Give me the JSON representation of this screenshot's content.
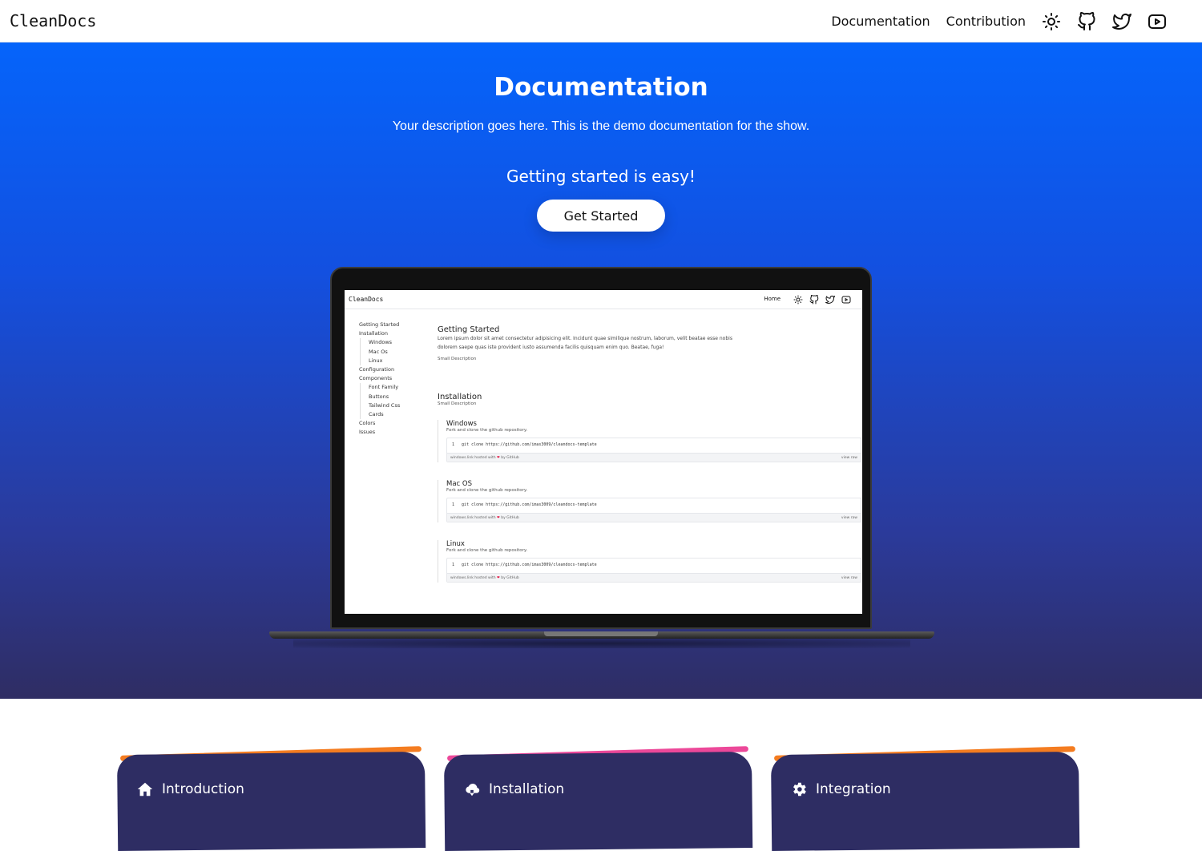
{
  "navbar": {
    "brand": "CleanDocs",
    "links": [
      "Documentation",
      "Contribution"
    ],
    "icons": [
      "sun-icon",
      "github-icon",
      "twitter-icon",
      "youtube-icon"
    ]
  },
  "hero": {
    "title": "Documentation",
    "description": "Your description goes here. This is the demo documentation for the show.",
    "subtitle": "Getting started is easy!",
    "cta_label": "Get Started",
    "gradient_colors": [
      "#0564fb",
      "#2f2d63"
    ]
  },
  "preview": {
    "brand": "CleanDocs",
    "nav_link": "Home",
    "sidebar": {
      "getting_started": "Getting Started",
      "installation": "Installation",
      "install_sub": [
        "Windows",
        "Mac Os",
        "Linux"
      ],
      "configuration": "Configuration",
      "components": "Components",
      "components_sub": [
        "Font Family",
        "Buttons",
        "Tailwind Css",
        "Cards"
      ],
      "colors": "Colors",
      "issues": "Issues"
    },
    "getting_started": {
      "title": "Getting Started",
      "body": "Lorem ipsum dolor sit amet consectetur adipisicing elit. Incidunt quae similique nostrum, laborum, velit beatae esse nobis dolorem saepe quas iste provident iusto assumenda facilis quisquam enim quo. Beatae, fuga!",
      "small": "Small Description"
    },
    "installation": {
      "title": "Installation",
      "small": "Small Description",
      "items": [
        {
          "name": "Windows",
          "desc": "Fork and clone the github repository.",
          "code": "git clone https://github.com/imas3009/cleandocs-template",
          "line": "1",
          "file": "windows.link",
          "hosted": "hosted with",
          "by": "by GitHub",
          "raw": "view raw"
        },
        {
          "name": "Mac OS",
          "desc": "Fork and clone the github repository.",
          "code": "git clone https://github.com/imas3009/cleandocs-template",
          "line": "1",
          "file": "windows.link",
          "hosted": "hosted with",
          "by": "by GitHub",
          "raw": "view raw"
        },
        {
          "name": "Linux",
          "desc": "Fork and clone the github repository.",
          "code": "git clone https://github.com/imas3009/cleandocs-template",
          "line": "1",
          "file": "windows.link",
          "hosted": "hosted with",
          "by": "by GitHub",
          "raw": "view raw"
        }
      ]
    }
  },
  "cards": [
    {
      "title": "Introduction",
      "icon": "home-icon",
      "accent": "#f47c20"
    },
    {
      "title": "Installation",
      "icon": "cloud-download-icon",
      "accent": "#ec4899"
    },
    {
      "title": "Integration",
      "icon": "gear-icon",
      "accent": "#f47c20"
    }
  ]
}
